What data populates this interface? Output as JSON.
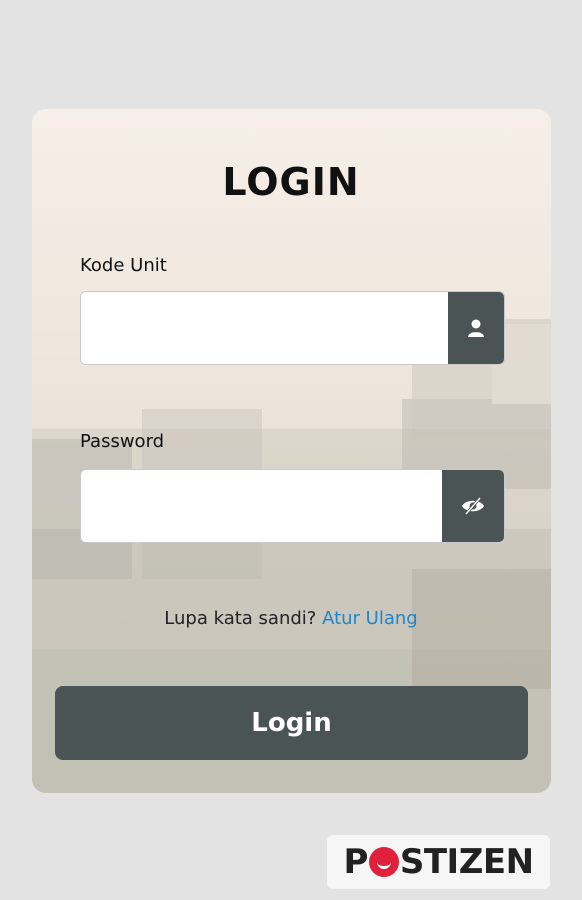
{
  "login": {
    "title": "LOGIN",
    "unit_label": "Kode Unit",
    "unit_value": "",
    "password_label": "Password",
    "password_value": "",
    "forgot_text": "Lupa kata sandi?",
    "reset_link": "Atur Ulang",
    "submit_label": "Login"
  },
  "brand": {
    "logo_text_pre": "P",
    "logo_text_post": "STIZEN",
    "logo_color": "#e0213b"
  },
  "icons": {
    "unit_addon": "user-icon",
    "password_addon": "eye-slash-icon"
  },
  "colors": {
    "button": "#4b5454",
    "link": "#1f86c9",
    "page_background": "#e3e3e3"
  }
}
